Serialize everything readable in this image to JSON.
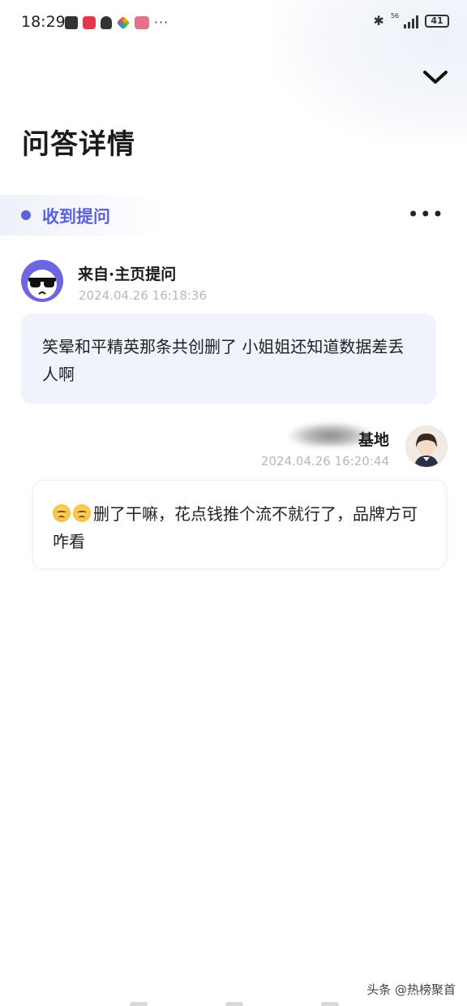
{
  "status_bar": {
    "time": "18:29",
    "network": "56",
    "battery": "41"
  },
  "page": {
    "title": "问答详情"
  },
  "section": {
    "label": "收到提问",
    "more": "•••"
  },
  "question": {
    "source": "来自·主页提问",
    "time": "2024.04.26 16:18:36",
    "text": "笑晕和平精英那条共创删了 小姐姐还知道数据差丢人啊"
  },
  "answer": {
    "name_visible": "基地",
    "time": "2024.04.26 16:20:44",
    "emojis": [
      "sad-sweat-emoji",
      "sad-sweat-emoji"
    ],
    "text": "删了干嘛，花点钱推个流不就行了，品牌方可咋看"
  },
  "watermark": "头条 @热榜聚首",
  "colors": {
    "accent": "#5a62d8",
    "question_bubble": "#f0f3fb",
    "timestamp": "#b8b8b8"
  }
}
